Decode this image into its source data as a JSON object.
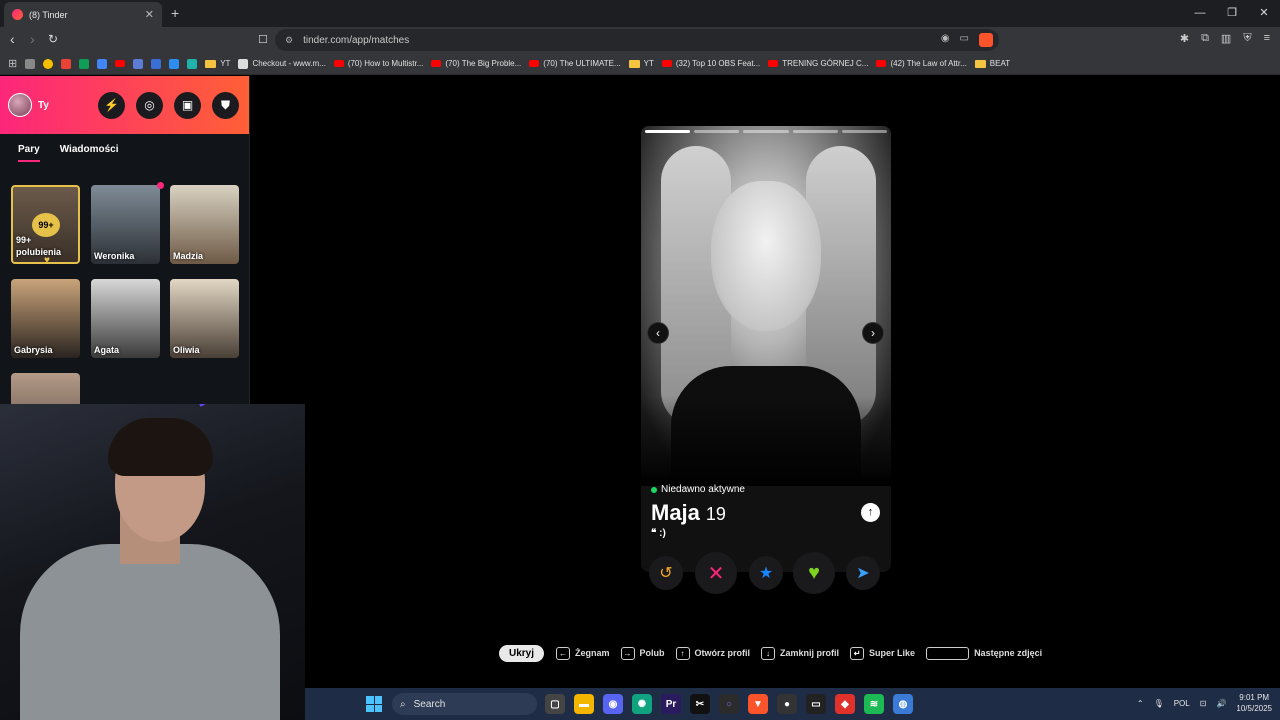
{
  "browser": {
    "tab_title": "(8) Tinder",
    "url": "tinder.com/app/matches",
    "bookmarks": [
      {
        "label": "YT",
        "kind": "folder"
      },
      {
        "label": "Checkout - www.m...",
        "kind": "page"
      },
      {
        "label": "(70) How to Multistr...",
        "kind": "yt"
      },
      {
        "label": "(70) The Big Proble...",
        "kind": "yt"
      },
      {
        "label": "(70) The ULTIMATE...",
        "kind": "yt"
      },
      {
        "label": "YT",
        "kind": "folder"
      },
      {
        "label": "(32) Top 10 OBS Feat...",
        "kind": "yt"
      },
      {
        "label": "TRENING GÓRNEJ C...",
        "kind": "yt"
      },
      {
        "label": "(42) The Law of Attr...",
        "kind": "yt"
      },
      {
        "label": "BEAT",
        "kind": "folder"
      }
    ]
  },
  "sidebar": {
    "user_name": "Ty",
    "tabs": [
      "Pary",
      "Wiadomości"
    ],
    "likes_badge": "99+",
    "likes_label": "99+ polubienia",
    "matches": [
      "Weronika",
      "Madzia",
      "Gabrysia",
      "Agata",
      "Oliwia"
    ]
  },
  "profile": {
    "status": "Niedawno aktywne",
    "name": "Maja",
    "age": "19",
    "bio": "❝ :)"
  },
  "hints": {
    "hide": "Ukryj",
    "nope": "Żegnam",
    "like": "Polub",
    "open": "Otwórz profil",
    "close": "Zamknij profil",
    "super": "Super Like",
    "next": "Następne zdjęci"
  },
  "taskbar": {
    "search": "Search",
    "lang": "POL",
    "time": "9:01 PM",
    "date": "10/5/2025"
  },
  "colors": {
    "brand_start": "#fd267a",
    "brand_end": "#ff6036",
    "like": "#1ed760",
    "super": "#1786ff",
    "nope": "#fd267a",
    "rewind": "#f5a623"
  }
}
